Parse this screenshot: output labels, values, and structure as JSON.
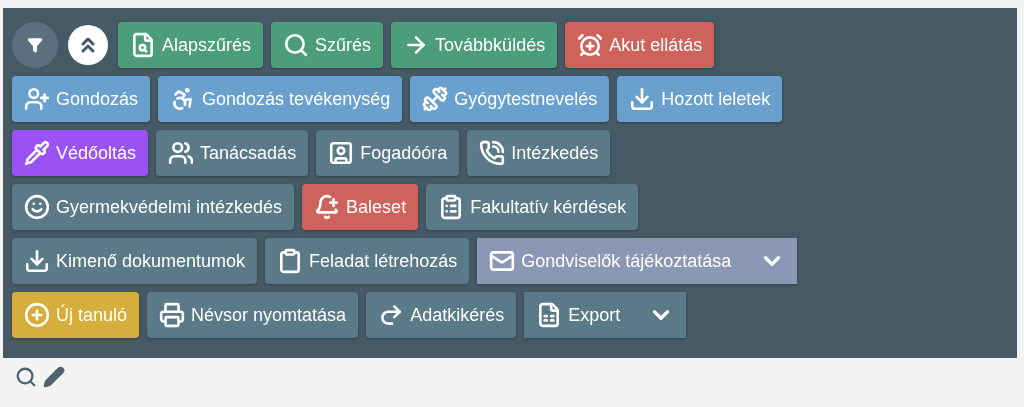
{
  "toolbar": {
    "rows": [
      [
        {
          "label": "Alapszűrés",
          "color": "#4b9d7b",
          "dropdown": false
        },
        {
          "label": "Szűrés",
          "color": "#4b9d7b",
          "dropdown": false
        },
        {
          "label": "Továbbküldés",
          "color": "#4b9d7b",
          "dropdown": false
        },
        {
          "label": "Akut ellátás",
          "color": "#cd635a",
          "dropdown": false
        }
      ],
      [
        {
          "label": "Gondozás",
          "color": "#6aa0cd",
          "dropdown": false
        },
        {
          "label": "Gondozás tevékenység",
          "color": "#6aa0cd",
          "dropdown": false
        },
        {
          "label": "Gyógytestnevelés",
          "color": "#6aa0cd",
          "dropdown": false
        },
        {
          "label": "Hozott leletek",
          "color": "#6aa0cd",
          "dropdown": false
        }
      ],
      [
        {
          "label": "Védőoltás",
          "color": "#9b52f5",
          "dropdown": false
        },
        {
          "label": "Tanácsadás",
          "color": "#5a7a88",
          "dropdown": false
        },
        {
          "label": "Fogadóóra",
          "color": "#5a7a88",
          "dropdown": false
        },
        {
          "label": "Intézkedés",
          "color": "#5a7a88",
          "dropdown": false
        }
      ],
      [
        {
          "label": "Gyermekvédelmi intézkedés",
          "color": "#5a7a88",
          "dropdown": false
        },
        {
          "label": "Baleset",
          "color": "#cd635a",
          "dropdown": false
        },
        {
          "label": "Fakultatív kérdések",
          "color": "#5a7a88",
          "dropdown": false
        }
      ],
      [
        {
          "label": "Kimenő dokumentumok",
          "color": "#5a7a88",
          "dropdown": false
        },
        {
          "label": "Feladat létrehozás",
          "color": "#5a7a88",
          "dropdown": false
        },
        {
          "label": "Gondviselők tájékoztatása",
          "color": "#8a97b5",
          "dropdown": true
        }
      ],
      [
        {
          "label": "Új tanuló",
          "color": "#d6ae3c",
          "dropdown": false
        },
        {
          "label": "Névsor nyomtatása",
          "color": "#5a7a88",
          "dropdown": false
        },
        {
          "label": "Adatkikérés",
          "color": "#5a7a88",
          "dropdown": false
        },
        {
          "label": "Export",
          "color": "#5a7a88",
          "dropdown": true
        }
      ]
    ]
  }
}
